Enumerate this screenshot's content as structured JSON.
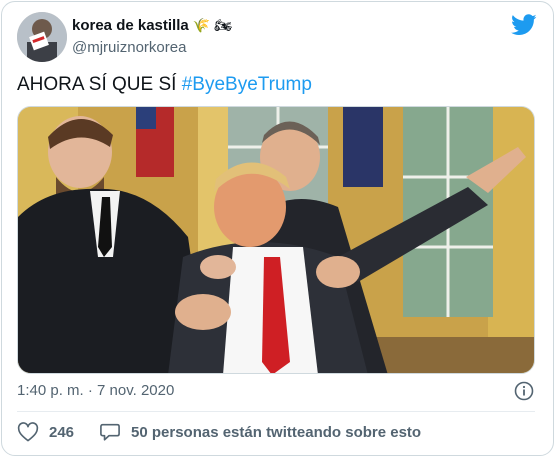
{
  "author": {
    "display_name": "korea de kastilla",
    "name_emoji": "🌾 🏍",
    "handle": "@mjruiznorkorea",
    "avatar_icon": "profile-avatar-icon"
  },
  "brand": {
    "icon": "twitter-bird-icon",
    "color": "#1d9bf0"
  },
  "tweet": {
    "text": "AHORA SÍ QUE SÍ ",
    "hashtag": "#ByeByeTrump"
  },
  "media": {
    "kind": "photo",
    "subject": "oval-office-scuffle-photo"
  },
  "meta": {
    "timestamp": "1:40 p. m. · 7 nov. 2020",
    "info_icon": "info-icon"
  },
  "actions": {
    "like_icon": "heart-icon",
    "like_count": "246",
    "reply_icon": "speech-bubble-icon",
    "reply_text": "50 personas están twitteando sobre esto"
  },
  "colors": {
    "text": "#0f1419",
    "secondary": "#536471",
    "link": "#1d9bf0",
    "border": "#cfd9de"
  }
}
